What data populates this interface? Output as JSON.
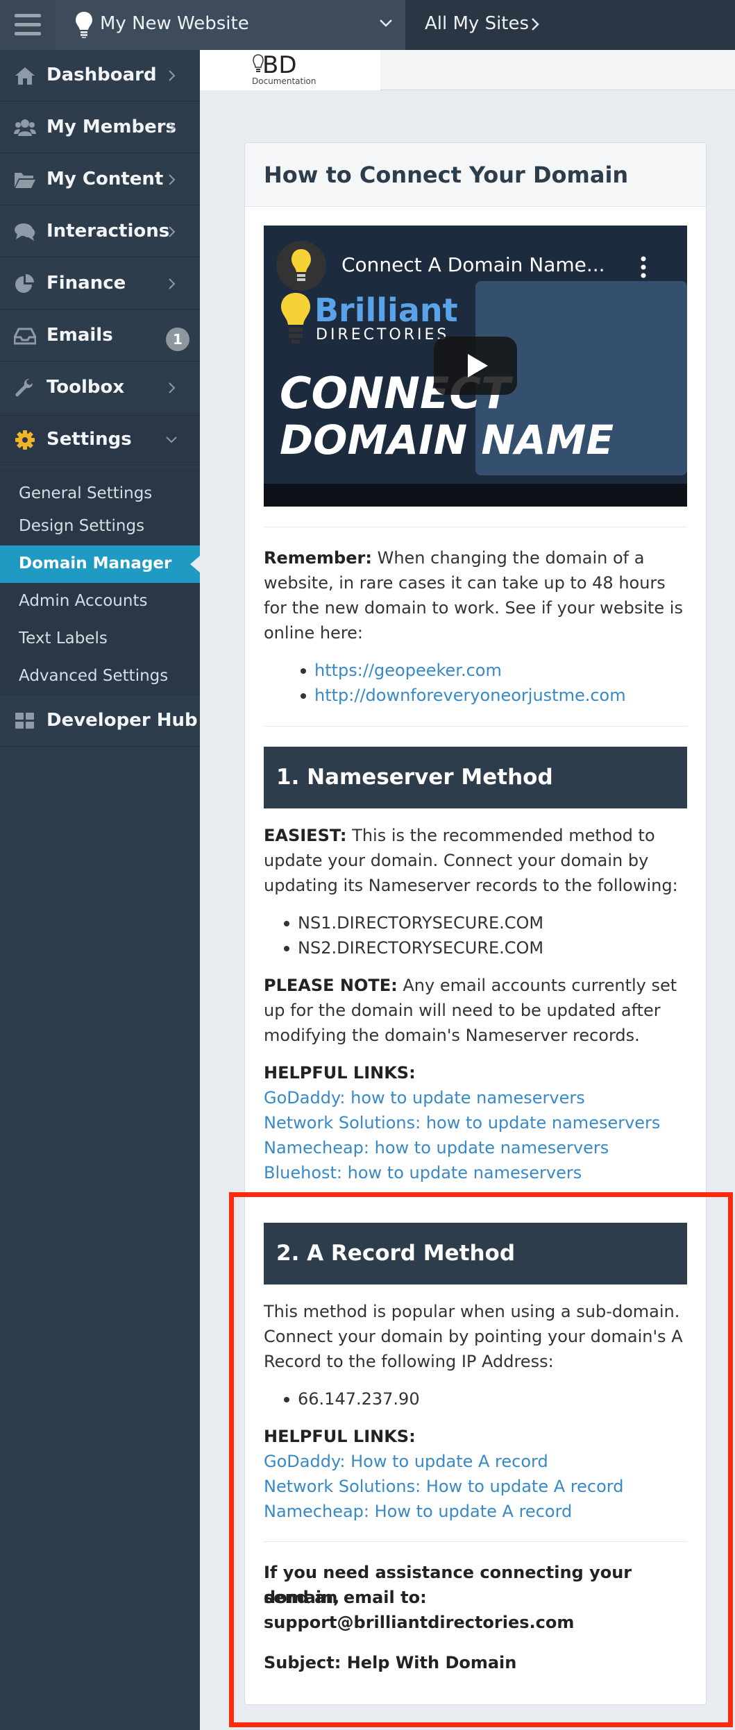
{
  "topbar": {
    "site_name": "My New Website",
    "all_sites_label": "All My Sites"
  },
  "sidebar": {
    "items": [
      {
        "label": "Dashboard",
        "icon": "home-icon"
      },
      {
        "label": "My Members",
        "icon": "users-icon"
      },
      {
        "label": "My Content",
        "icon": "folder-icon"
      },
      {
        "label": "Interactions",
        "icon": "comments-icon"
      },
      {
        "label": "Finance",
        "icon": "pie-chart-icon"
      },
      {
        "label": "Emails",
        "icon": "inbox-icon",
        "badge": "1"
      },
      {
        "label": "Toolbox",
        "icon": "wrench-icon"
      },
      {
        "label": "Settings",
        "icon": "gear-icon",
        "expanded": true
      }
    ],
    "settings_sub": [
      {
        "label": "General Settings"
      },
      {
        "label": "Design Settings"
      },
      {
        "label": "Domain Manager",
        "active": true
      },
      {
        "label": "Admin Accounts"
      },
      {
        "label": "Text Labels"
      },
      {
        "label": "Advanced Settings"
      }
    ],
    "developer_hub": {
      "label": "Developer Hub",
      "icon": "grid-icon"
    }
  },
  "logo": {
    "letters": "BD",
    "caption": "Documentation"
  },
  "card": {
    "title": "How to Connect Your Domain",
    "video": {
      "title": "Connect A Domain Name...",
      "brand": "Brilliant",
      "brand_sub": "DIRECTORIES",
      "headline_1": "CONNECT",
      "headline_2": "DOMAIN NAME"
    },
    "remember": {
      "lead": "Remember:",
      "text": " When changing the domain of a website, in rare cases it can take up to 48 hours for the new domain to work. See if your website is online here:",
      "links": [
        "https://geopeeker.com",
        "http://downforeveryoneorjustme.com"
      ]
    },
    "nameserver": {
      "heading": "1. Nameserver Method",
      "lead": "EASIEST:",
      "text": " This is the recommended method to update your domain. Connect your domain by updating its Nameserver records to the following:",
      "servers": [
        "NS1.DIRECTORYSECURE.COM",
        "NS2.DIRECTORYSECURE.COM"
      ],
      "note_lead": "PLEASE NOTE:",
      "note_text": " Any email accounts currently set up for the domain will need to be updated after modifying the domain's Nameserver records.",
      "helpful_label": "HELPFUL LINKS:",
      "links": [
        "GoDaddy: how to update nameservers",
        "Network Solutions: how to update nameservers",
        "Namecheap: how to update nameservers",
        "Bluehost: how to update nameservers"
      ]
    },
    "a_record": {
      "heading": "2. A Record Method",
      "text": "This method is popular when using a sub-domain. Connect your domain by pointing your domain's A Record to the following IP Address:",
      "ip": "66.147.237.90",
      "helpful_label": "HELPFUL LINKS:",
      "links": [
        "GoDaddy: How to update A record",
        "Network Solutions: How to update A record",
        "Namecheap: How to update A record"
      ]
    },
    "assistance": {
      "line1": "If you need assistance connecting your domain,",
      "line2": "send an email to:",
      "email": "support@brilliantdirectories.com",
      "subject": "Subject: Help With Domain"
    }
  },
  "colors": {
    "sidebar_bg": "#2e3d4c",
    "active_accent": "#1f9ac3",
    "link": "#3789c7",
    "highlight_border": "#ff2a0e",
    "settings_icon": "#f0b429"
  }
}
